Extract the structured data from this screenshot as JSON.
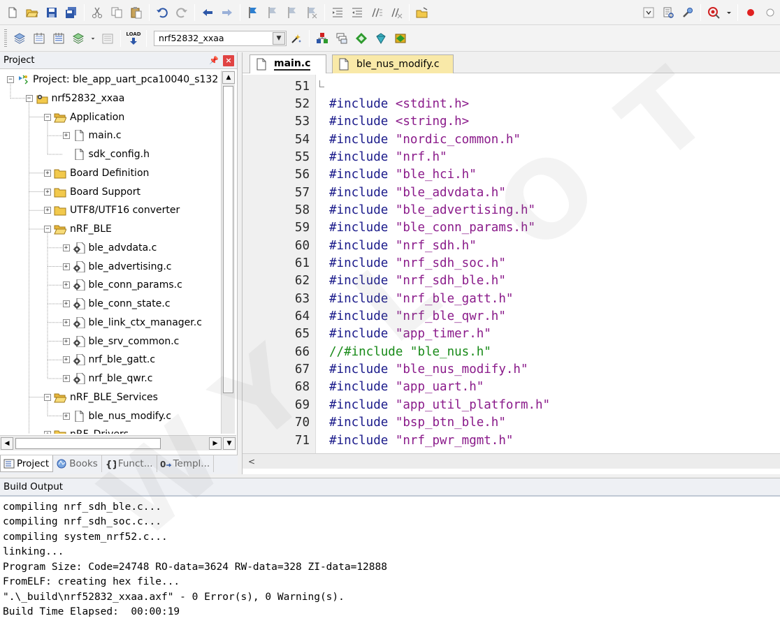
{
  "toolbar2": {
    "target": "nrf52832_xxaa",
    "load_label": "LOAD"
  },
  "project_panel": {
    "title": "Project",
    "tree": [
      {
        "label": "Project: ble_app_uart_pca10040_s132",
        "level": 0,
        "icon": "project-icon",
        "expander": "-"
      },
      {
        "label": "nrf52832_xxaa",
        "level": 1,
        "icon": "target-icon",
        "expander": "-"
      },
      {
        "label": "Application",
        "level": 2,
        "icon": "folder-open-icon",
        "expander": "-"
      },
      {
        "label": "main.c",
        "level": 3,
        "icon": "file-icon",
        "expander": "+"
      },
      {
        "label": "sdk_config.h",
        "level": 3,
        "icon": "file-icon",
        "expander": ""
      },
      {
        "label": "Board Definition",
        "level": 2,
        "icon": "folder-icon",
        "expander": "+"
      },
      {
        "label": "Board Support",
        "level": 2,
        "icon": "folder-icon",
        "expander": "+"
      },
      {
        "label": "UTF8/UTF16 converter",
        "level": 2,
        "icon": "folder-icon",
        "expander": "+"
      },
      {
        "label": "nRF_BLE",
        "level": 2,
        "icon": "folder-open-icon",
        "expander": "-"
      },
      {
        "label": "ble_advdata.c",
        "level": 3,
        "icon": "gear-file-icon",
        "expander": "+"
      },
      {
        "label": "ble_advertising.c",
        "level": 3,
        "icon": "gear-file-icon",
        "expander": "+"
      },
      {
        "label": "ble_conn_params.c",
        "level": 3,
        "icon": "gear-file-icon",
        "expander": "+"
      },
      {
        "label": "ble_conn_state.c",
        "level": 3,
        "icon": "gear-file-icon",
        "expander": "+"
      },
      {
        "label": "ble_link_ctx_manager.c",
        "level": 3,
        "icon": "gear-file-icon",
        "expander": "+"
      },
      {
        "label": "ble_srv_common.c",
        "level": 3,
        "icon": "gear-file-icon",
        "expander": "+"
      },
      {
        "label": "nrf_ble_gatt.c",
        "level": 3,
        "icon": "gear-file-icon",
        "expander": "+"
      },
      {
        "label": "nrf_ble_qwr.c",
        "level": 3,
        "icon": "gear-file-icon",
        "expander": "+"
      },
      {
        "label": "nRF_BLE_Services",
        "level": 2,
        "icon": "folder-open-icon",
        "expander": "-"
      },
      {
        "label": "ble_nus_modify.c",
        "level": 3,
        "icon": "file-icon",
        "expander": "+"
      },
      {
        "label": "nRF_Drivers",
        "level": 2,
        "icon": "folder-icon",
        "expander": "+"
      }
    ],
    "tabs": [
      {
        "label": "Project",
        "active": true
      },
      {
        "label": "Books",
        "active": false
      },
      {
        "label": "Funct...",
        "active": false
      },
      {
        "label": "Templ...",
        "active": false
      }
    ]
  },
  "editor": {
    "tabs": [
      {
        "label": "main.c",
        "active": true
      },
      {
        "label": "ble_nus_modify.c",
        "active": false
      }
    ],
    "lines": [
      {
        "n": "51",
        "kind": "blank",
        "directive": "",
        "arg": ""
      },
      {
        "n": "52",
        "kind": "sys",
        "directive": "#include",
        "arg": "<stdint.h>"
      },
      {
        "n": "53",
        "kind": "sys",
        "directive": "#include",
        "arg": "<string.h>"
      },
      {
        "n": "54",
        "kind": "inc",
        "directive": "#include",
        "arg": "\"nordic_common.h\""
      },
      {
        "n": "55",
        "kind": "inc",
        "directive": "#include",
        "arg": "\"nrf.h\""
      },
      {
        "n": "56",
        "kind": "inc",
        "directive": "#include",
        "arg": "\"ble_hci.h\""
      },
      {
        "n": "57",
        "kind": "inc",
        "directive": "#include",
        "arg": "\"ble_advdata.h\""
      },
      {
        "n": "58",
        "kind": "inc",
        "directive": "#include",
        "arg": "\"ble_advertising.h\""
      },
      {
        "n": "59",
        "kind": "inc",
        "directive": "#include",
        "arg": "\"ble_conn_params.h\""
      },
      {
        "n": "60",
        "kind": "inc",
        "directive": "#include",
        "arg": "\"nrf_sdh.h\""
      },
      {
        "n": "61",
        "kind": "inc",
        "directive": "#include",
        "arg": "\"nrf_sdh_soc.h\""
      },
      {
        "n": "62",
        "kind": "inc",
        "directive": "#include",
        "arg": "\"nrf_sdh_ble.h\""
      },
      {
        "n": "63",
        "kind": "inc",
        "directive": "#include",
        "arg": "\"nrf_ble_gatt.h\""
      },
      {
        "n": "64",
        "kind": "inc",
        "directive": "#include",
        "arg": "\"nrf_ble_qwr.h\""
      },
      {
        "n": "65",
        "kind": "inc",
        "directive": "#include",
        "arg": "\"app_timer.h\""
      },
      {
        "n": "66",
        "kind": "comment",
        "directive": "//#include",
        "arg": "\"ble_nus.h\""
      },
      {
        "n": "67",
        "kind": "inc",
        "directive": "#include",
        "arg": "\"ble_nus_modify.h\""
      },
      {
        "n": "68",
        "kind": "inc",
        "directive": "#include",
        "arg": "\"app_uart.h\""
      },
      {
        "n": "69",
        "kind": "inc",
        "directive": "#include",
        "arg": "\"app_util_platform.h\""
      },
      {
        "n": "70",
        "kind": "inc",
        "directive": "#include",
        "arg": "\"bsp_btn_ble.h\""
      },
      {
        "n": "71",
        "kind": "inc",
        "directive": "#include",
        "arg": "\"nrf_pwr_mgmt.h\""
      }
    ],
    "hscroll_arrow": "<"
  },
  "build_output": {
    "title": "Build Output",
    "lines": [
      "compiling nrf_sdh_ble.c...",
      "compiling nrf_sdh_soc.c...",
      "compiling system_nrf52.c...",
      "linking...",
      "Program Size: Code=24748 RO-data=3624 RW-data=328 ZI-data=12888",
      "FromELF: creating hex file...",
      "\".\\_build\\nrf52832_xxaa.axf\" - 0 Error(s), 0 Warning(s).",
      "Build Time Elapsed:  00:00:19"
    ]
  },
  "colors": {
    "keyword": "#1a1a8a",
    "string": "#8a1a8a",
    "comment": "#188a18",
    "tab_inactive": "#f9e9a8",
    "record_dot": "#e02020"
  }
}
